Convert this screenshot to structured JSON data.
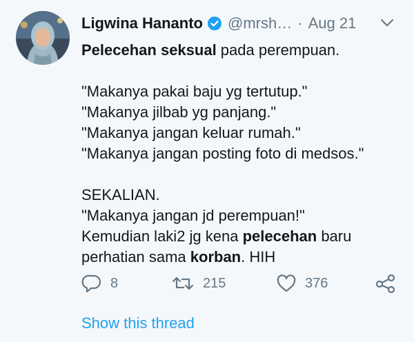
{
  "author": {
    "name": "Ligwina Hananto",
    "handle": "@mrsh…",
    "separator": "·",
    "date": "Aug 21"
  },
  "icons": {
    "verified": "verified-badge-icon",
    "more": "chevron-down-icon",
    "reply": "reply-icon",
    "retweet": "retweet-icon",
    "like": "heart-icon",
    "share": "share-icon"
  },
  "colors": {
    "background": "#f5f8fa",
    "text": "#14171a",
    "muted": "#657786",
    "accent": "#1da1f2"
  },
  "tweet": {
    "line1_bold": "Pelecehan seksual",
    "line1_rest": " pada perempuan.",
    "quote1": "\"Makanya pakai baju yg tertutup.\"",
    "quote2": "\"Makanya jilbab yg panjang.\"",
    "quote3": "\"Makanya jangan keluar rumah.\"",
    "quote4": "\"Makanya jangan posting foto di medsos.\"",
    "sekalian": "SEKALIAN.",
    "quote5": "\"Makanya jangan jd perempuan!\"",
    "line_k1_pre": "Kemudian laki2 jg kena ",
    "line_k1_bold": "pelecehan",
    "line_k1_post": " baru",
    "line_k2_pre": "perhatian sama ",
    "line_k2_bold": "korban",
    "line_k2_post": ". HIH"
  },
  "stats": {
    "replies": "8",
    "retweets": "215",
    "likes": "376"
  },
  "show_thread": "Show this thread"
}
